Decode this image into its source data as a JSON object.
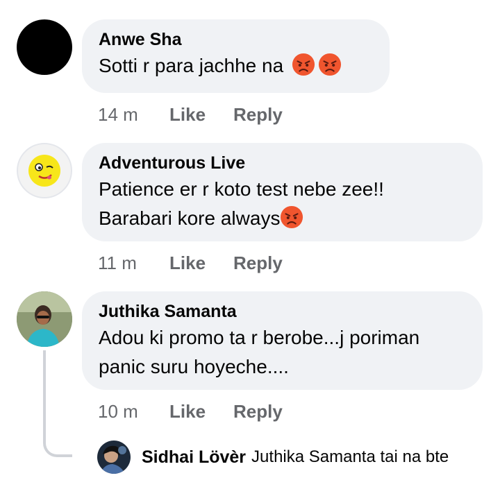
{
  "comments": [
    {
      "author": "Anwe Sha",
      "text_lines": [
        "Sotti r para jachhe na"
      ],
      "emoji_icons": [
        "angry-face-icon",
        "angry-face-icon"
      ],
      "time": "14 m",
      "like_label": "Like",
      "reply_label": "Reply"
    },
    {
      "author": "Adventurous Live",
      "text_lines": [
        "Patience er r koto test nebe zee!!",
        "Barabari kore always"
      ],
      "emoji_icons": [
        "angry-face-icon"
      ],
      "time": "11 m",
      "like_label": "Like",
      "reply_label": "Reply"
    },
    {
      "author": "Juthika Samanta",
      "text_lines": [
        "Adou ki promo ta r berobe...j poriman",
        "panic suru hoyeche...."
      ],
      "time": "10 m",
      "like_label": "Like",
      "reply_label": "Reply"
    }
  ],
  "reply_preview": {
    "author": "Sidhai Lövèr",
    "text": "Juthika Samanta tai na bte"
  },
  "colors": {
    "bubble": "#f0f2f5",
    "meta_text": "#65676b",
    "emoji_face": "#f0552e",
    "thread_line": "#d0d3d8"
  }
}
